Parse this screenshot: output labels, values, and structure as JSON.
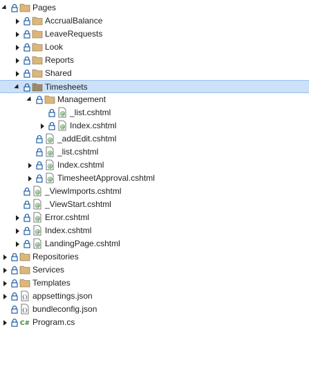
{
  "tree": {
    "items": [
      {
        "label": "Pages",
        "type": "folder",
        "expander": "expanded",
        "depth": 0
      },
      {
        "label": "AccrualBalance",
        "type": "folder",
        "expander": "collapsed",
        "depth": 1
      },
      {
        "label": "LeaveRequests",
        "type": "folder",
        "expander": "collapsed",
        "depth": 1
      },
      {
        "label": "Look",
        "type": "folder",
        "expander": "collapsed",
        "depth": 1
      },
      {
        "label": "Reports",
        "type": "folder",
        "expander": "collapsed",
        "depth": 1
      },
      {
        "label": "Shared",
        "type": "folder",
        "expander": "collapsed",
        "depth": 1
      },
      {
        "label": "Timesheets",
        "type": "folder-dark",
        "expander": "expanded",
        "depth": 1,
        "selected": true
      },
      {
        "label": "Management",
        "type": "folder",
        "expander": "expanded",
        "depth": 2
      },
      {
        "label": "_list.cshtml",
        "type": "cshtml",
        "expander": "none",
        "depth": 3
      },
      {
        "label": "Index.cshtml",
        "type": "cshtml",
        "expander": "collapsed",
        "depth": 3
      },
      {
        "label": "_addEdit.cshtml",
        "type": "cshtml",
        "expander": "none",
        "depth": 2
      },
      {
        "label": "_list.cshtml",
        "type": "cshtml",
        "expander": "none",
        "depth": 2
      },
      {
        "label": "Index.cshtml",
        "type": "cshtml",
        "expander": "collapsed",
        "depth": 2
      },
      {
        "label": "TimesheetApproval.cshtml",
        "type": "cshtml",
        "expander": "collapsed",
        "depth": 2
      },
      {
        "label": "_ViewImports.cshtml",
        "type": "cshtml",
        "expander": "none",
        "depth": 1
      },
      {
        "label": "_ViewStart.cshtml",
        "type": "cshtml",
        "expander": "none",
        "depth": 1
      },
      {
        "label": "Error.cshtml",
        "type": "cshtml",
        "expander": "collapsed",
        "depth": 1
      },
      {
        "label": "Index.cshtml",
        "type": "cshtml",
        "expander": "collapsed",
        "depth": 1
      },
      {
        "label": "LandingPage.cshtml",
        "type": "cshtml",
        "expander": "collapsed",
        "depth": 1
      },
      {
        "label": "Repositories",
        "type": "folder",
        "expander": "collapsed",
        "depth": 0
      },
      {
        "label": "Services",
        "type": "folder",
        "expander": "collapsed",
        "depth": 0
      },
      {
        "label": "Templates",
        "type": "folder",
        "expander": "collapsed",
        "depth": 0
      },
      {
        "label": "appsettings.json",
        "type": "json",
        "expander": "collapsed",
        "depth": 0
      },
      {
        "label": "bundleconfig.json",
        "type": "json",
        "expander": "none",
        "depth": 0
      },
      {
        "label": "Program.cs",
        "type": "cs",
        "expander": "collapsed",
        "depth": 0
      }
    ]
  },
  "colors": {
    "folder": "#dcb67a",
    "folder_dark": "#9b8a6a",
    "lock": "#1f5fa8",
    "razor": "#388a34",
    "cs": "#388a34",
    "selection": "#cce0f7"
  }
}
